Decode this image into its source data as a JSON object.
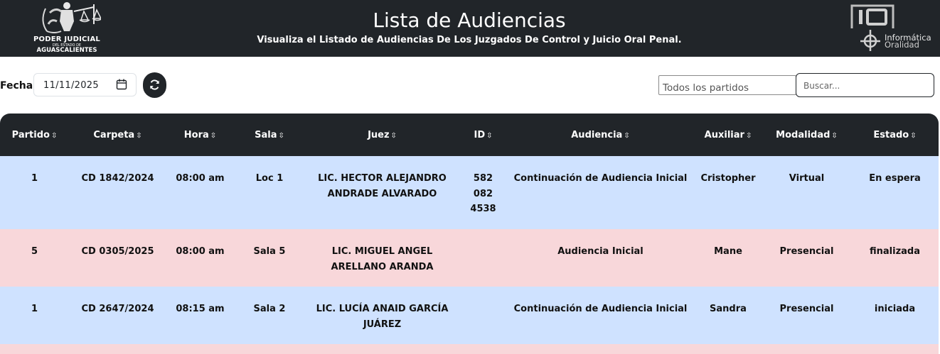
{
  "header": {
    "title": "Lista de Audiencias",
    "subtitle": "Visualiza el Listado de Audiencias De Los Juzgados De Control y Juicio Oral Penal.",
    "logo_left": {
      "line1": "PODER JUDICIAL",
      "line2": "DEL ESTADO DE",
      "line3": "AGUASCALIENTES",
      "icon": "justice-scale-emblem"
    },
    "logo_right": {
      "line1": "Informática",
      "line2": "Oralidad",
      "icon": "io-logo"
    },
    "colors": {
      "background": "#212529",
      "text": "#ffffff"
    }
  },
  "filters": {
    "fecha_label": "Fecha:",
    "date_value": "11/11/2025",
    "refresh_icon": "refresh-icon",
    "partido_select": "Todos los partidos",
    "search_placeholder": "Buscar..."
  },
  "table": {
    "columns": [
      "Partido",
      "Carpeta",
      "Hora",
      "Sala",
      "Juez",
      "ID",
      "Audiencia",
      "Auxiliar",
      "Modalidad",
      "Estado"
    ],
    "sort_icon": "⇳",
    "rows": [
      {
        "partido": "1",
        "carpeta": "CD 1842/2024",
        "hora": "08:00 am",
        "sala": "Loc 1",
        "juez": "LIC. HECTOR ALEJANDRO ANDRADE ALVARADO",
        "id": "582 082 4538",
        "audiencia": "Continuación de Audiencia Inicial",
        "auxiliar": "Cristopher",
        "modalidad": "Virtual",
        "estado": "En espera"
      },
      {
        "partido": "5",
        "carpeta": "CD 0305/2025",
        "hora": "08:00 am",
        "sala": "Sala 5",
        "juez": "LIC. MIGUEL ANGEL ARELLANO ARANDA",
        "id": "",
        "audiencia": "Audiencia Inicial",
        "auxiliar": "Mane",
        "modalidad": "Presencial",
        "estado": "finalizada"
      },
      {
        "partido": "1",
        "carpeta": "CD 2647/2024",
        "hora": "08:15 am",
        "sala": "Sala 2",
        "juez": "LIC. LUCÍA ANAID GARCÍA JUÁREZ",
        "id": "",
        "audiencia": "Continuación de Audiencia Inicial",
        "auxiliar": "Sandra",
        "modalidad": "Presencial",
        "estado": "iniciada"
      }
    ],
    "colors": {
      "header": "#212529",
      "row_blue": "#cfe2ff",
      "row_pink": "#f8d7da"
    }
  }
}
